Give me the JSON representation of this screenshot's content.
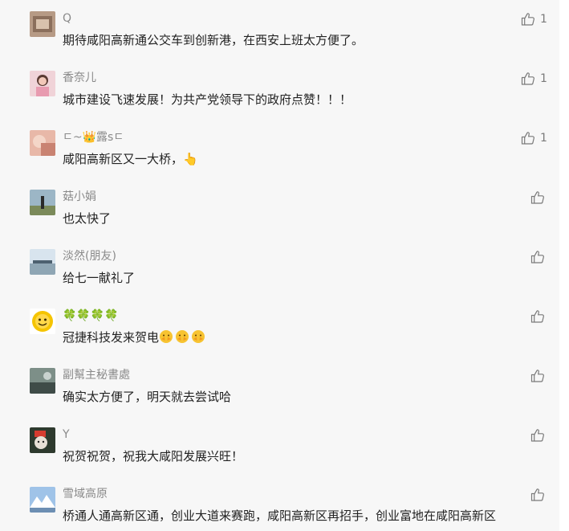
{
  "comments": [
    {
      "name": "Q",
      "text": "期待咸阳高新通公交车到创新港，在西安上班太方便了。",
      "likes": "1"
    },
    {
      "name": "香奈儿",
      "text": "城市建设飞速发展！为共产党领导下的政府点赞！！！",
      "likes": "1"
    },
    {
      "name": "ㄷ~👑露sㄷ",
      "text": "咸阳高新区又一大桥，👆",
      "likes": "1"
    },
    {
      "name": "菇小娟",
      "text": "也太快了",
      "likes": ""
    },
    {
      "name": "淡然(朋友)",
      "text": "给七一献礼了",
      "likes": ""
    },
    {
      "name": "🍀🍀🍀🍀",
      "text": "冠捷科技发来贺电",
      "likes": ""
    },
    {
      "name": "副幫主秘書處",
      "text": "确实太方便了，明天就去尝试哈",
      "likes": ""
    },
    {
      "name": "Y",
      "text": "祝贺祝贺，祝我大咸阳发展兴旺！",
      "likes": ""
    },
    {
      "name": "雪域高原",
      "text": "桥通人通高新区通，创业大道来赛跑，咸阳高新区再招手，创业富地在咸阳高新区",
      "likes": ""
    }
  ],
  "colors": {
    "background": "#f7f7f7",
    "nickname": "#8a8a8a",
    "text": "#222222",
    "icon": "#7a7a7a"
  },
  "icons": {
    "like": "thumbs-up-outline-icon",
    "emoji": "applause-emoji-icon"
  }
}
